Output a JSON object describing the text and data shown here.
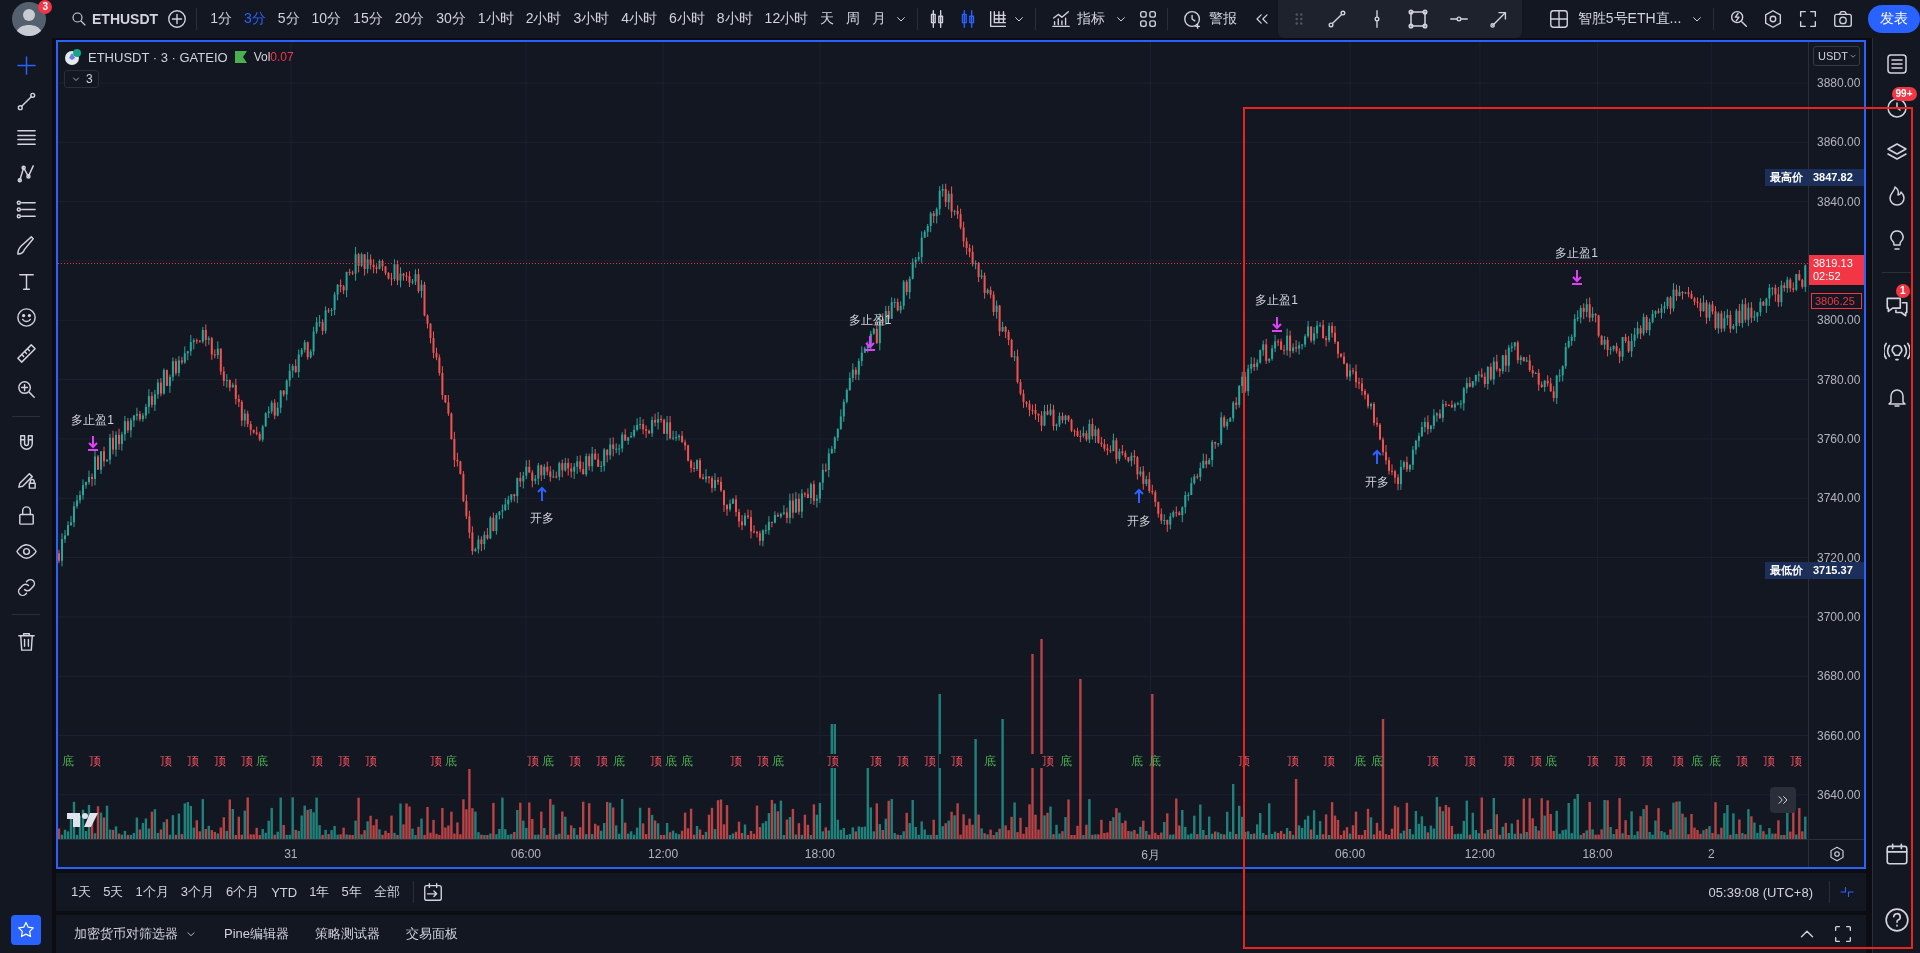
{
  "top_bar": {
    "notification_count": "3",
    "symbol": "ETHUSDT",
    "intervals": [
      {
        "label": "1分",
        "selected": false
      },
      {
        "label": "3分",
        "selected": true
      },
      {
        "label": "5分",
        "selected": false
      },
      {
        "label": "10分",
        "selected": false
      },
      {
        "label": "15分",
        "selected": false
      },
      {
        "label": "20分",
        "selected": false
      },
      {
        "label": "30分",
        "selected": false
      },
      {
        "label": "1小时",
        "selected": false
      },
      {
        "label": "2小时",
        "selected": false
      },
      {
        "label": "3小时",
        "selected": false
      },
      {
        "label": "4小时",
        "selected": false
      },
      {
        "label": "6小时",
        "selected": false
      },
      {
        "label": "8小时",
        "selected": false
      },
      {
        "label": "12小时",
        "selected": false
      },
      {
        "label": "天",
        "selected": false
      },
      {
        "label": "周",
        "selected": false
      },
      {
        "label": "月",
        "selected": false
      }
    ],
    "indicators": "指标",
    "alerts": "警报",
    "layout_name": "智胜5号ETH直...",
    "publish": "发表"
  },
  "chart": {
    "legend": {
      "title": "ETHUSDT · 3 · GATEIO",
      "volume_label": "Vol",
      "volume_value": "0.07",
      "collapse_count": "3"
    },
    "currency": "USDT",
    "price_ticks": [
      "3880.00",
      "3860.00",
      "3840.00",
      "3800.00",
      "3780.00",
      "3760.00",
      "3740.00",
      "3720.00",
      "3700.00",
      "3680.00",
      "3660.00",
      "3640.00"
    ],
    "price_badges": [
      {
        "kind": "high",
        "label": "最高价",
        "value": "3847.82"
      },
      {
        "kind": "last",
        "value": "3819.13",
        "countdown": "02:52"
      },
      {
        "kind": "previous",
        "value": "3806.25"
      },
      {
        "kind": "low",
        "label": "最低价",
        "value": "3715.37"
      }
    ],
    "time_ticks": [
      "31",
      "06:00",
      "12:00",
      "18:00",
      "6月",
      "06:00",
      "12:00",
      "18:00",
      "2"
    ],
    "signals": [
      {
        "kind": "take_profit",
        "label": "多止盈1"
      },
      {
        "kind": "open_long",
        "label": "开多"
      },
      {
        "kind": "take_profit",
        "label": "多止盈1"
      },
      {
        "kind": "open_long",
        "label": "开多"
      },
      {
        "kind": "take_profit",
        "label": "多止盈1"
      },
      {
        "kind": "open_long",
        "label": "开多"
      },
      {
        "kind": "take_profit",
        "label": "多止盈1"
      }
    ],
    "pivots": [
      {
        "kind": "bottom",
        "label": "底"
      },
      {
        "kind": "top",
        "label": "顶"
      },
      {
        "kind": "top",
        "label": "顶"
      },
      {
        "kind": "top",
        "label": "顶"
      },
      {
        "kind": "top",
        "label": "顶"
      },
      {
        "kind": "top",
        "label": "顶"
      },
      {
        "kind": "bottom",
        "label": "底"
      },
      {
        "kind": "top",
        "label": "顶"
      },
      {
        "kind": "top",
        "label": "顶"
      },
      {
        "kind": "top",
        "label": "顶"
      },
      {
        "kind": "top",
        "label": "顶"
      },
      {
        "kind": "bottom",
        "label": "底"
      },
      {
        "kind": "top",
        "label": "顶"
      },
      {
        "kind": "bottom",
        "label": "底"
      },
      {
        "kind": "top",
        "label": "顶"
      },
      {
        "kind": "top",
        "label": "顶"
      },
      {
        "kind": "bottom",
        "label": "底"
      },
      {
        "kind": "top",
        "label": "顶"
      },
      {
        "kind": "bottom",
        "label": "底"
      },
      {
        "kind": "bottom",
        "label": "底"
      },
      {
        "kind": "top",
        "label": "顶"
      },
      {
        "kind": "top",
        "label": "顶"
      },
      {
        "kind": "bottom",
        "label": "底"
      },
      {
        "kind": "top",
        "label": "顶"
      },
      {
        "kind": "top",
        "label": "顶"
      },
      {
        "kind": "top",
        "label": "顶"
      },
      {
        "kind": "top",
        "label": "顶"
      },
      {
        "kind": "top",
        "label": "顶"
      },
      {
        "kind": "bottom",
        "label": "底"
      },
      {
        "kind": "top",
        "label": "顶"
      },
      {
        "kind": "bottom",
        "label": "底"
      },
      {
        "kind": "bottom",
        "label": "底"
      },
      {
        "kind": "bottom",
        "label": "底"
      },
      {
        "kind": "top",
        "label": "顶"
      },
      {
        "kind": "top",
        "label": "顶"
      },
      {
        "kind": "top",
        "label": "顶"
      },
      {
        "kind": "bottom",
        "label": "底"
      },
      {
        "kind": "bottom",
        "label": "底"
      },
      {
        "kind": "top",
        "label": "顶"
      },
      {
        "kind": "top",
        "label": "顶"
      },
      {
        "kind": "top",
        "label": "顶"
      },
      {
        "kind": "top",
        "label": "顶"
      },
      {
        "kind": "bottom",
        "label": "底"
      },
      {
        "kind": "top",
        "label": "顶"
      },
      {
        "kind": "top",
        "label": "顶"
      },
      {
        "kind": "top",
        "label": "顶"
      },
      {
        "kind": "top",
        "label": "顶"
      },
      {
        "kind": "bottom",
        "label": "底"
      },
      {
        "kind": "bottom",
        "label": "底"
      },
      {
        "kind": "top",
        "label": "顶"
      },
      {
        "kind": "top",
        "label": "顶"
      },
      {
        "kind": "top",
        "label": "顶"
      }
    ]
  },
  "range_bar": {
    "ranges": [
      "1天",
      "5天",
      "1个月",
      "3个月",
      "6个月",
      "YTD",
      "1年",
      "5年",
      "全部"
    ],
    "clock": "05:39:08 (UTC+8)"
  },
  "bottom_tabs": [
    {
      "label": "加密货币对筛选器",
      "dropdown": true
    },
    {
      "label": "Pine编辑器",
      "dropdown": false
    },
    {
      "label": "策略测试器",
      "dropdown": false
    },
    {
      "label": "交易面板",
      "dropdown": false
    }
  ],
  "right_sidebar": {
    "alerts_badge": "99+",
    "chat_badge": "1"
  }
}
